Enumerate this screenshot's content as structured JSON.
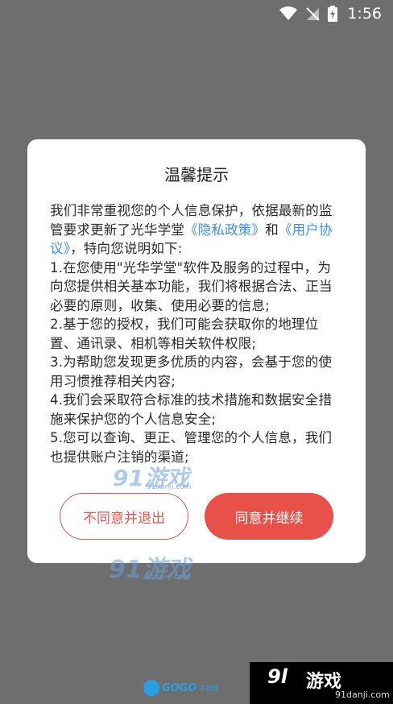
{
  "status_bar": {
    "time": "1:56",
    "icons": [
      "wifi-icon",
      "signal-off-icon",
      "battery-charging-icon"
    ]
  },
  "dialog": {
    "title": "温馨提示",
    "intro_pre": "我们非常重视您的个人信息保护，依据最新的监管要求更新了光华学堂",
    "privacy_link": "《隐私政策》",
    "intro_and": "和",
    "agreement_link": "《用户协议》",
    "intro_post": "，特向您说明如下:",
    "items": [
      "1.在您使用\"光华学堂\"软件及服务的过程中，为向您提供相关基本功能，我们将根据合法、正当必要的原则，收集、使用必要的信息;",
      "2.基于您的授权，我们可能会获取你的地理位置、通讯录、相机等相关软件权限;",
      "3.为帮助您发现更多优质的内容，会基于您的使用习惯推荐相关内容;",
      "4.我们会采取符合标准的技术措施和数据安全措施来保护您的个人信息安全;",
      "5.您可以查询、更正、管理您的个人信息，我们也提供账户注销的渠道;"
    ],
    "decline_label": "不同意并退出",
    "accept_label": "同意并继续"
  },
  "watermarks": {
    "logo_1": "91游戏",
    "sub_1": "91danji.com",
    "logo_2": "91游戏",
    "sub_2": "91danji.com"
  },
  "bottom": {
    "gogo_text": "GOGO",
    "gogo_sub": "手游网",
    "brand_num": "9l",
    "brand_main": "游戏",
    "brand_url": "91danji.com"
  },
  "colors": {
    "overlay": "#6e6e6e",
    "accent_red": "#e8514a",
    "link_blue": "#3a8ee6"
  }
}
